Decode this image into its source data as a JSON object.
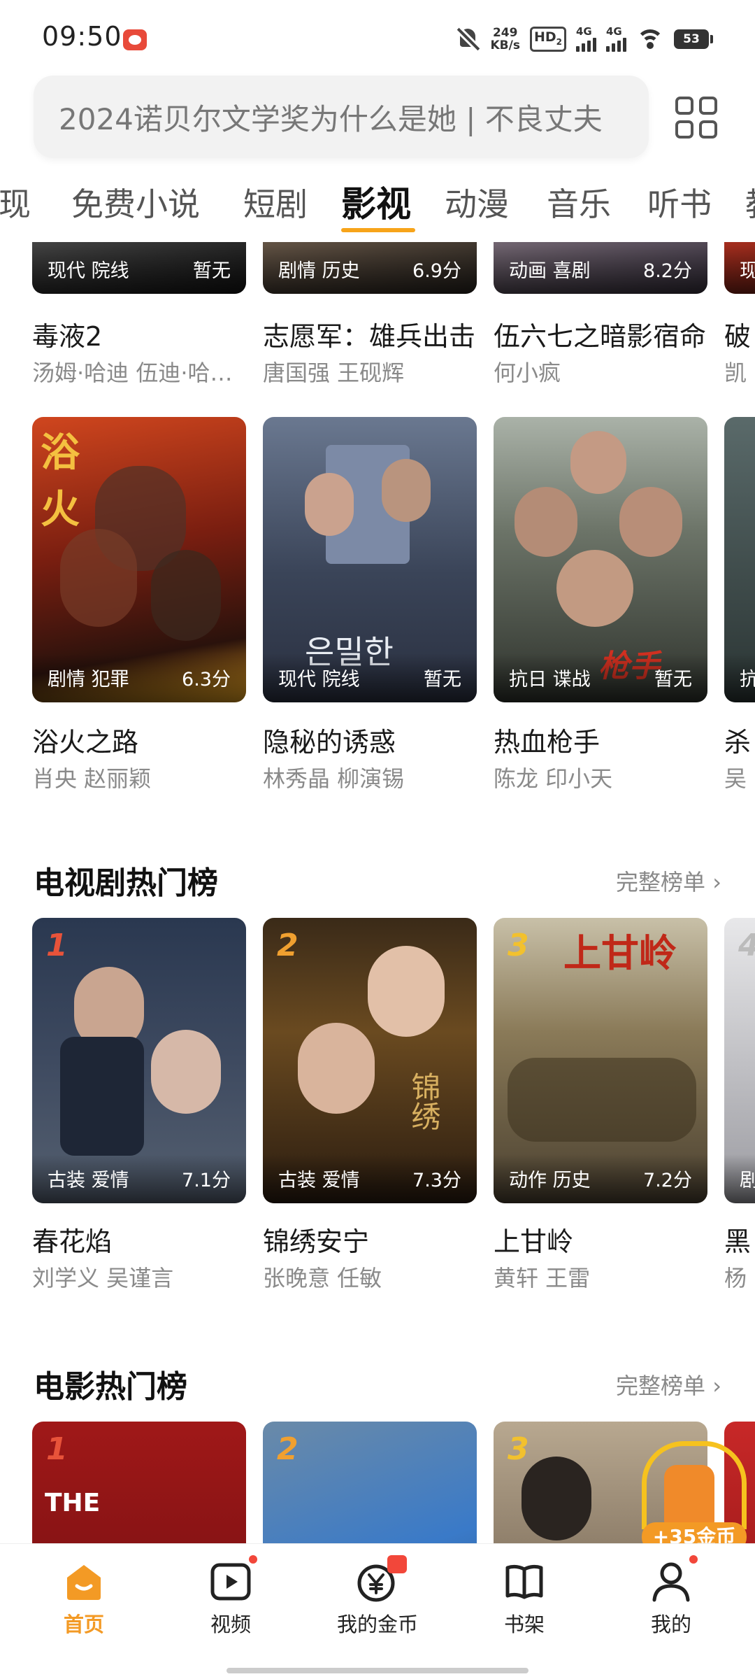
{
  "status_bar": {
    "time": "09:50",
    "net_speed_value": "249",
    "net_speed_unit": "KB/s",
    "hd_label": "HD",
    "hd_sub": "2",
    "signal1_label": "4G",
    "signal2_label": "4G",
    "battery": "53",
    "icons": [
      "app-notification-icon",
      "bell-off-icon",
      "wifi-icon",
      "battery-icon"
    ]
  },
  "search": {
    "placeholder": "2024诺贝尔文学奖为什么是她 | 不良丈夫"
  },
  "tabs": [
    {
      "label": "现"
    },
    {
      "label": "免费小说"
    },
    {
      "label": "短剧"
    },
    {
      "label": "影视"
    },
    {
      "label": "动漫"
    },
    {
      "label": "音乐"
    },
    {
      "label": "听书"
    },
    {
      "label": "教"
    }
  ],
  "active_tab": "影视",
  "row1": [
    {
      "genre": "现代 院线",
      "score": "暂无",
      "title": "毒液2",
      "cast": "汤姆·哈迪 伍迪·哈里森"
    },
    {
      "genre": "剧情 历史",
      "score": "6.9分",
      "title": "志愿军：雄兵出击",
      "cast": "唐国强 王砚辉"
    },
    {
      "genre": "动画 喜剧",
      "score": "8.2分",
      "title": "伍六七之暗影宿命",
      "cast": "何小疯"
    },
    {
      "genre": "现",
      "score": "",
      "title": "破",
      "cast": "凯"
    }
  ],
  "row2": [
    {
      "genre": "剧情 犯罪",
      "score": "6.3分",
      "title": "浴火之路",
      "cast": "肖央 赵丽颖",
      "poster_text": "浴火"
    },
    {
      "genre": "现代 院线",
      "score": "暂无",
      "title": "隐秘的诱惑",
      "cast": "林秀晶 柳演锡",
      "poster_text": "은밀한"
    },
    {
      "genre": "抗日 谍战",
      "score": "暂无",
      "title": "热血枪手",
      "cast": "陈龙 印小天",
      "poster_text": "枪手"
    },
    {
      "genre": "抗",
      "score": "",
      "title": "杀",
      "cast": "吴"
    }
  ],
  "tv_section": {
    "title": "电视剧热门榜",
    "more": "完整榜单"
  },
  "tv_list": [
    {
      "rank": "1",
      "genre": "古装 爱情",
      "score": "7.1分",
      "title": "春花焰",
      "cast": "刘学义 吴谨言"
    },
    {
      "rank": "2",
      "genre": "古装 爱情",
      "score": "7.3分",
      "title": "锦绣安宁",
      "cast": "张晚意 任敏",
      "poster_text": "锦绣"
    },
    {
      "rank": "3",
      "genre": "动作 历史",
      "score": "7.2分",
      "title": "上甘岭",
      "cast": "黄轩 王雷",
      "poster_text": "上甘岭"
    },
    {
      "rank": "4",
      "genre": "剧",
      "score": "",
      "title": "黑",
      "cast": "杨"
    }
  ],
  "movie_section": {
    "title": "电影热门榜",
    "more": "完整榜单"
  },
  "movie_list": [
    {
      "rank": "1",
      "poster_text": "THE"
    },
    {
      "rank": "2"
    },
    {
      "rank": "3"
    },
    {
      "rank": ""
    }
  ],
  "coin_badge": "+35金币",
  "bottom_nav": [
    {
      "label": "首页",
      "icon": "home-icon"
    },
    {
      "label": "视频",
      "icon": "video-icon"
    },
    {
      "label": "我的金币",
      "icon": "coin-icon"
    },
    {
      "label": "书架",
      "icon": "bookshelf-icon"
    },
    {
      "label": "我的",
      "icon": "profile-icon"
    }
  ],
  "colors": {
    "accent": "#f39a25",
    "tab_underline": "#f7a41a",
    "rank_1": "#e8533a",
    "rank_2": "#f0a030",
    "rank_3": "#f2c12e",
    "red_dot": "#f2473a"
  }
}
